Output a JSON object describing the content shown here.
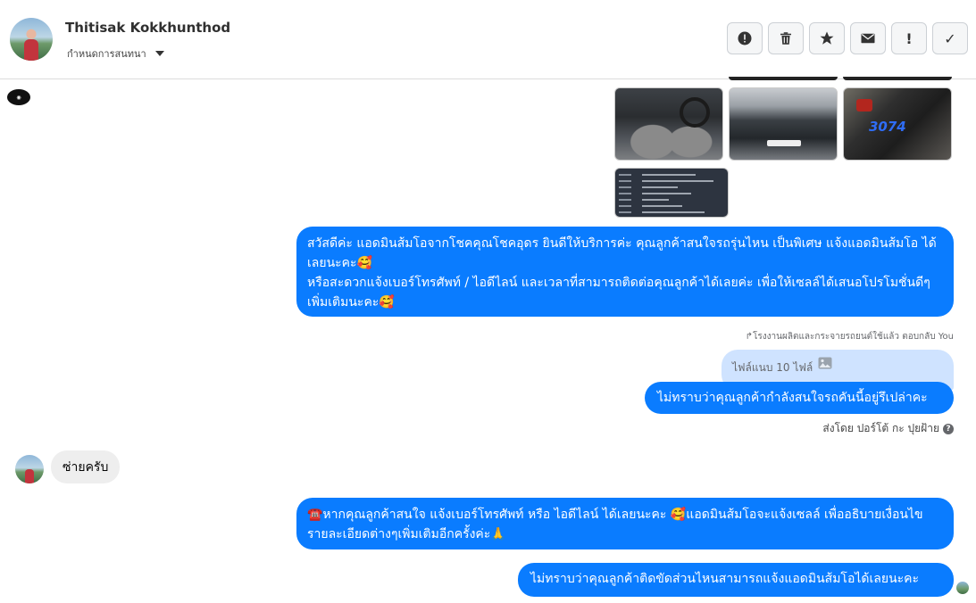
{
  "header": {
    "contact_name": "Thitisak Kokkhunthod",
    "assign_label": "กำหนดการสนทนา",
    "actions": [
      "!",
      "✓"
    ]
  },
  "icons": {
    "alert": "alert-circle-icon",
    "trash": "trash-icon",
    "star": "star-icon",
    "mail": "mail-icon",
    "spam": "exclamation-icon",
    "done": "check-icon"
  },
  "colors": {
    "outgoing_bubble": "#0a7cff",
    "incoming_bubble": "#eeeeee",
    "reply_box": "#cfe3ff"
  },
  "thread": {
    "image_scribble": "3074",
    "message_1_line_1": "สวัสดีค่ะ แอดมินส้มโอจากโชคคุณโชคอุดร ยินดีให้บริการค่ะ   คุณลูกค้าสนใจรถรุ่นไหน เป็นพิเศษ แจ้งแอดมินส้มโอ ได้เลยนะคะ🥰",
    "message_1_line_2": "หรือสะดวกแจ้งเบอร์โทรศัพท์ / ไอดีไลน์ และเวลาที่สามารถติดต่อคุณลูกค้าได้เลยค่ะ เพื่อให้เซลล์ได้เสนอโปรโมชั่นดีๆเพิ่มเติมนะคะ🥰",
    "reply_note": "↱โรงงานผลิตและกระจายรถยนต์ใช้แล้ว ตอบกลับ You",
    "reply_attachment": "ไฟล์แนบ 10 ไฟล์",
    "message_2": "ไม่ทราบว่าคุณลูกค้ากำลังสนใจรถคันนี้อยู่รึเปล่าคะ",
    "sent_by": "ส่งโดย ปอร์โต้ กะ ปุยฝ้าย",
    "incoming_1": "ซ่ายครับ",
    "message_3": "☎️หากคุณลูกค้าสนใจ แจ้งเบอร์โทรศัพท์ หรือ ไอดีไลน์  ได้เลยนะคะ 🥰แอดมินส้มโอจะแจ้งเซลล์   เพื่ออธิบายเงื่อนไขรายละเอียดต่างๆเพิ่มเติมอีกครั้งค่ะ🙏",
    "message_4": "ไม่ทราบว่าคุณลูกค้าติดขัดส่วนไหนสามารถแจ้งแอดมินส้มโอได้เลยนะคะ"
  }
}
